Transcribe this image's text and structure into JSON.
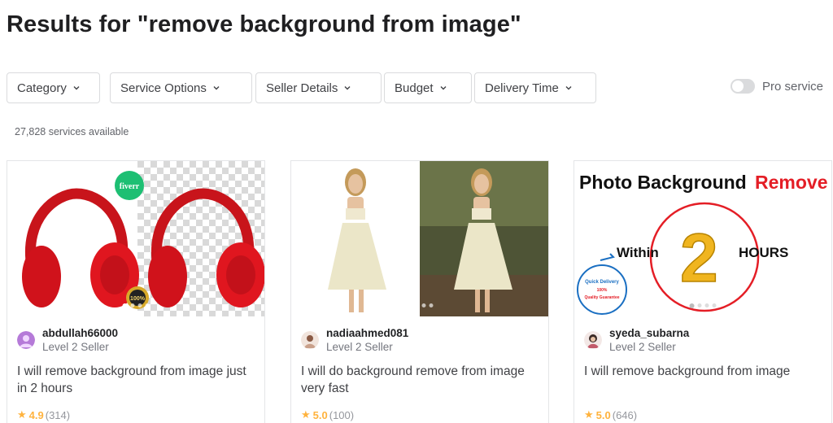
{
  "header": {
    "title": "Results for \"remove background from image\""
  },
  "filters": [
    {
      "label": "Category"
    },
    {
      "label": "Service Options"
    },
    {
      "label": "Seller Details"
    },
    {
      "label": "Budget"
    },
    {
      "label": "Delivery Time"
    }
  ],
  "pro_service": {
    "label": "Pro service",
    "enabled": false
  },
  "results": {
    "count_text": "27,828 services available"
  },
  "gigs": [
    {
      "seller": "abdullah66000",
      "level": "Level 2 Seller",
      "title": "I will remove background from image just in 2 hours",
      "rating": "4.9",
      "reviews": "(314)",
      "image": {
        "badge": "fiverr",
        "seal": "100%"
      }
    },
    {
      "seller": "nadiaahmed081",
      "level": "Level 2 Seller",
      "title": "I will do background remove from image very fast",
      "rating": "5.0",
      "reviews": "(100)"
    },
    {
      "seller": "syeda_subarna",
      "level": "Level 2 Seller",
      "title": "I will remove background from image",
      "rating": "5.0",
      "reviews": "(646)",
      "image": {
        "headline_a": "Photo Background",
        "headline_b": "Remove",
        "within": "Within",
        "number": "2",
        "hours": "HOURS",
        "badge_line1": "Quick Delivery",
        "badge_line2": "100%",
        "badge_line3": "Quality Guarantee"
      }
    }
  ],
  "colors": {
    "accent_red": "#e41e26",
    "star": "#ffb33e",
    "fiverr_green": "#1dbf73"
  }
}
